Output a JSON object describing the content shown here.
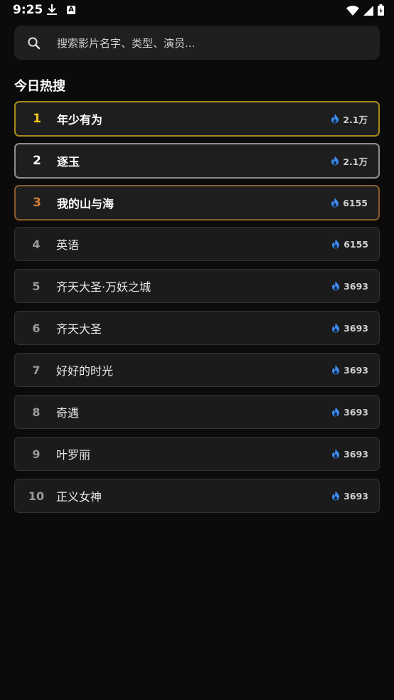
{
  "status_bar": {
    "time": "9:25",
    "icons": [
      "download-icon",
      "a-icon",
      "wifi-icon",
      "signal-icon",
      "battery-icon"
    ]
  },
  "search": {
    "placeholder": "搜索影片名字、类型、演员...",
    "icon": "search-icon"
  },
  "section": {
    "title": "今日热搜"
  },
  "colors": {
    "background": "#0b0b0b",
    "card": "#1b1b1b",
    "gold": "#f4c81a",
    "silver": "#ffffff",
    "bronze": "#cf7f33",
    "flame": "#3e8cf0"
  },
  "hot_list": [
    {
      "rank": "1",
      "title": "年少有为",
      "heat": "2.1万"
    },
    {
      "rank": "2",
      "title": "逐玉",
      "heat": "2.1万"
    },
    {
      "rank": "3",
      "title": "我的山与海",
      "heat": "6155"
    },
    {
      "rank": "4",
      "title": "英语",
      "heat": "6155"
    },
    {
      "rank": "5",
      "title": "齐天大圣·万妖之城",
      "heat": "3693"
    },
    {
      "rank": "6",
      "title": "齐天大圣",
      "heat": "3693"
    },
    {
      "rank": "7",
      "title": "好好的时光",
      "heat": "3693"
    },
    {
      "rank": "8",
      "title": "奇遇",
      "heat": "3693"
    },
    {
      "rank": "9",
      "title": "叶罗丽",
      "heat": "3693"
    },
    {
      "rank": "10",
      "title": "正义女神",
      "heat": "3693"
    }
  ]
}
